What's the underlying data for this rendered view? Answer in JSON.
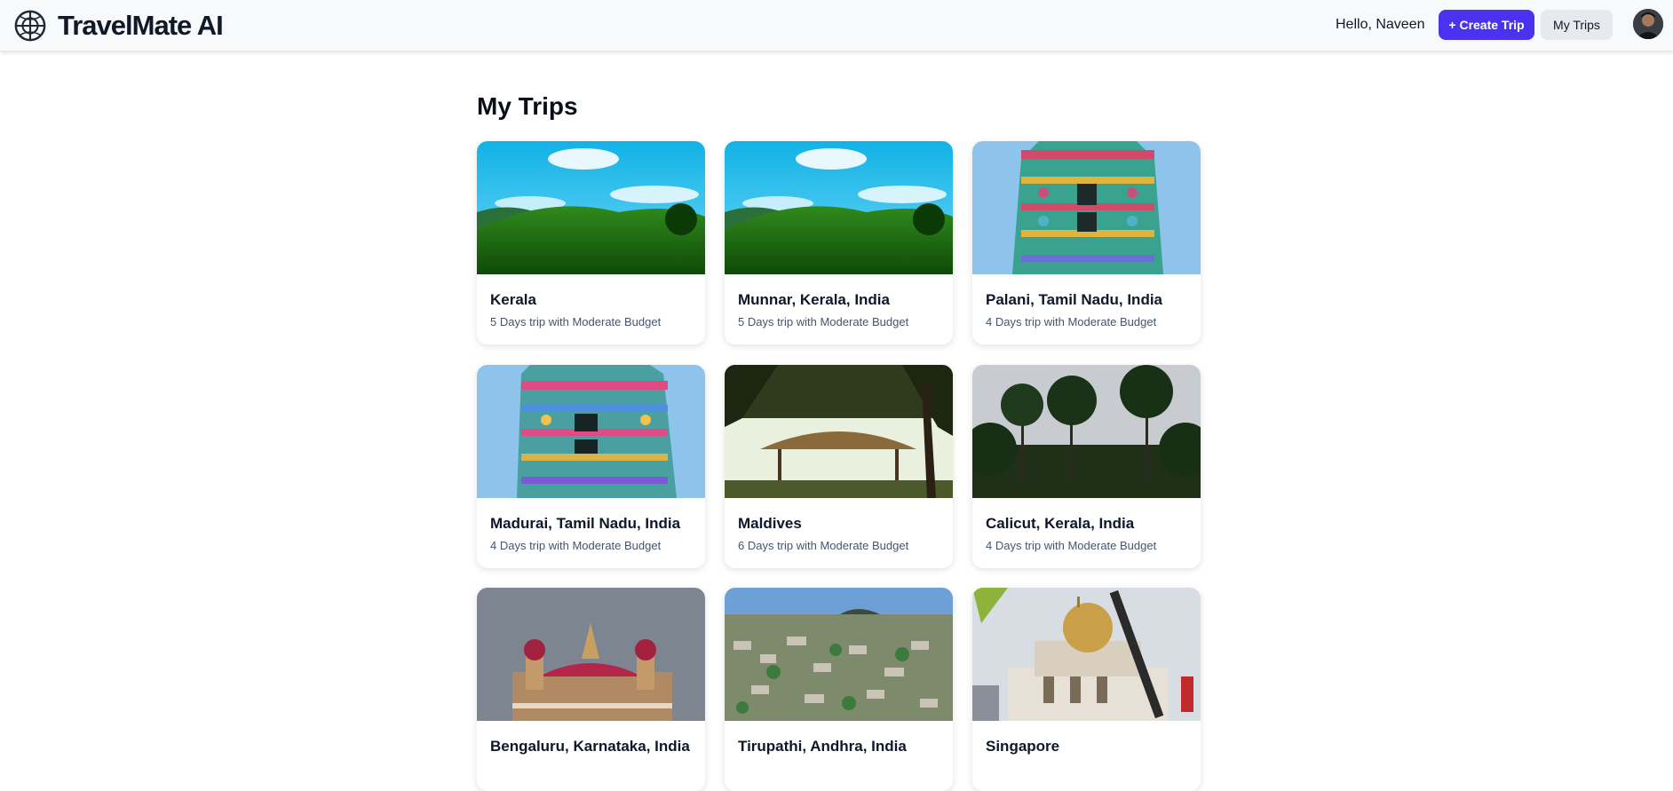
{
  "app": {
    "name": "TravelMate AI",
    "logo_icon": "globe-icon"
  },
  "header": {
    "greeting": "Hello, Naveen",
    "create_trip_label": "+ Create Trip",
    "my_trips_label": "My Trips",
    "avatar_icon": "user-avatar"
  },
  "colors": {
    "accent": "#4b32f0",
    "secondary_button": "#e7e9ec"
  },
  "page": {
    "title": "My Trips"
  },
  "trips": [
    {
      "title": "Kerala",
      "subtitle": "5 Days trip with Moderate Budget",
      "image": "tea-hills"
    },
    {
      "title": "Munnar, Kerala, India",
      "subtitle": "5 Days trip with Moderate Budget",
      "image": "tea-hills"
    },
    {
      "title": "Palani, Tamil Nadu, India",
      "subtitle": "4 Days trip with Moderate Budget",
      "image": "temple-tower"
    },
    {
      "title": "Madurai, Tamil Nadu, India",
      "subtitle": "4 Days trip with Moderate Budget",
      "image": "temple-tower"
    },
    {
      "title": "Maldives",
      "subtitle": "6 Days trip with Moderate Budget",
      "image": "palm-hut"
    },
    {
      "title": "Calicut, Kerala, India",
      "subtitle": "4 Days trip with Moderate Budget",
      "image": "palm-trees"
    },
    {
      "title": "Bengaluru, Karnataka, India",
      "subtitle": "",
      "image": "palace"
    },
    {
      "title": "Tirupathi, Andhra, India",
      "subtitle": "",
      "image": "city-aerial"
    },
    {
      "title": "Singapore",
      "subtitle": "",
      "image": "mosque"
    }
  ]
}
